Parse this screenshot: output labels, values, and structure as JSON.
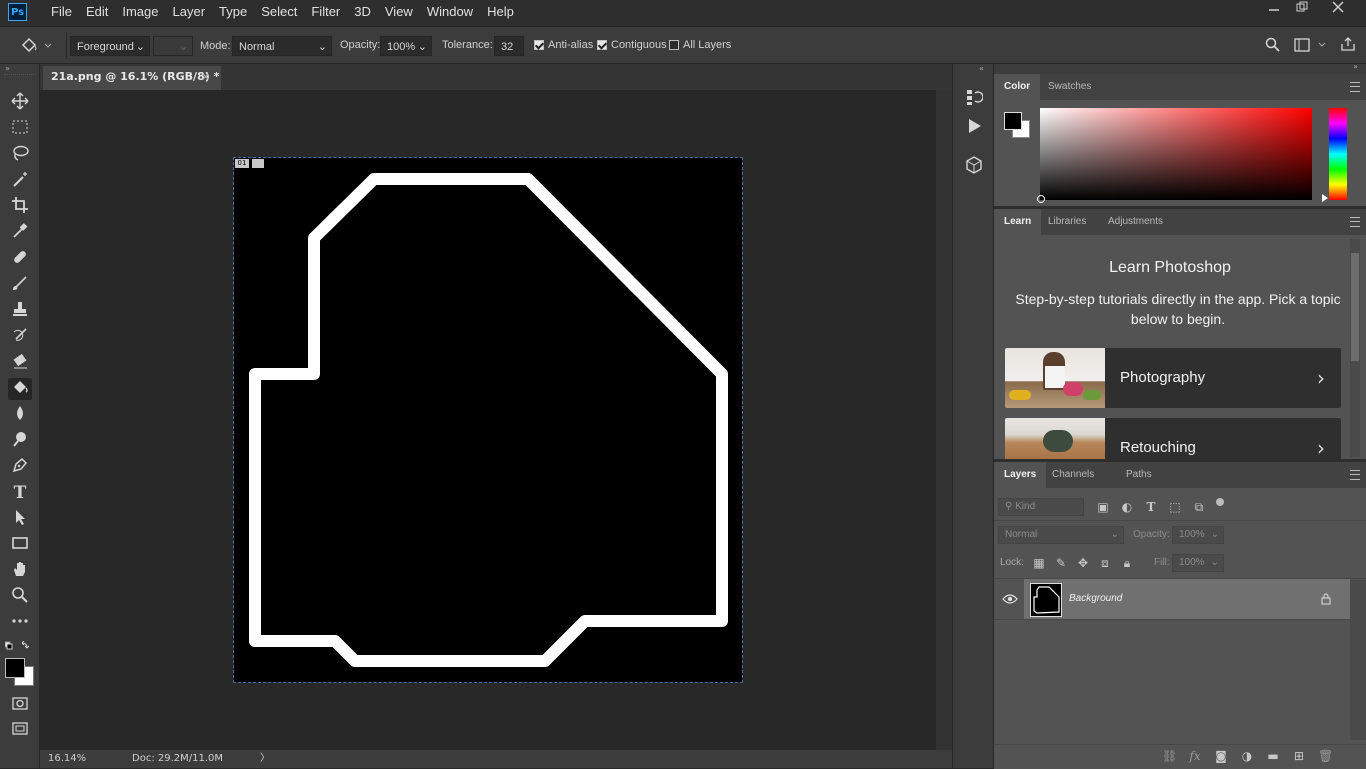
{
  "menubar": {
    "logo": "Ps",
    "items": [
      "File",
      "Edit",
      "Image",
      "Layer",
      "Type",
      "Select",
      "Filter",
      "3D",
      "View",
      "Window",
      "Help"
    ]
  },
  "options": {
    "fill_source": "Foreground",
    "mode_label": "Mode:",
    "mode_value": "Normal",
    "opacity_label": "Opacity:",
    "opacity_value": "100%",
    "tolerance_label": "Tolerance:",
    "tolerance_value": "32",
    "antialias_label": "Anti-alias",
    "antialias_checked": true,
    "contiguous_label": "Contiguous",
    "contiguous_checked": true,
    "alllayers_label": "All Layers",
    "alllayers_checked": false
  },
  "document": {
    "tab_title": "21a.png @ 16.1% (RGB/8) *",
    "tab_close": "×",
    "canvas_badge_1": "01",
    "zoom": "16.14%",
    "doc_size": "Doc: 29.2M/11.0M",
    "status_arrow": "〉"
  },
  "color_panel": {
    "tabs": [
      "Color",
      "Swatches"
    ],
    "foreground": "#000000",
    "background": "#ffffff",
    "hue": "#ff0000"
  },
  "learn_panel": {
    "tabs": [
      "Learn",
      "Libraries",
      "Adjustments"
    ],
    "title": "Learn Photoshop",
    "subtitle": "Step-by-step tutorials directly in the app. Pick a topic below to begin.",
    "cards": [
      {
        "label": "Photography",
        "chevron": "›"
      },
      {
        "label": "Retouching",
        "chevron": "›"
      }
    ]
  },
  "layers_panel": {
    "tabs": [
      "Layers",
      "Channels",
      "Paths"
    ],
    "kind_placeholder": "Kind",
    "blend_mode": "Normal",
    "opacity_label": "Opacity:",
    "opacity_value": "100%",
    "lock_label": "Lock:",
    "fill_label": "Fill:",
    "fill_value": "100%",
    "layers": [
      {
        "name": "Background",
        "visible": true,
        "locked": true
      }
    ],
    "footer_icons": [
      "link-icon",
      "fx-icon",
      "mask-icon",
      "adjustment-icon",
      "group-icon",
      "new-layer-icon",
      "delete-icon"
    ]
  },
  "tools": [
    "move-icon",
    "marquee-icon",
    "lasso-icon",
    "magic-wand-icon",
    "crop-icon",
    "eyedropper-icon",
    "healing-icon",
    "brush-icon",
    "stamp-icon",
    "history-brush-icon",
    "eraser-icon",
    "paint-bucket-icon",
    "blur-icon",
    "dodge-icon",
    "pen-icon",
    "type-icon",
    "path-select-icon",
    "rectangle-icon",
    "hand-icon",
    "zoom-icon",
    "more-tools-icon"
  ]
}
